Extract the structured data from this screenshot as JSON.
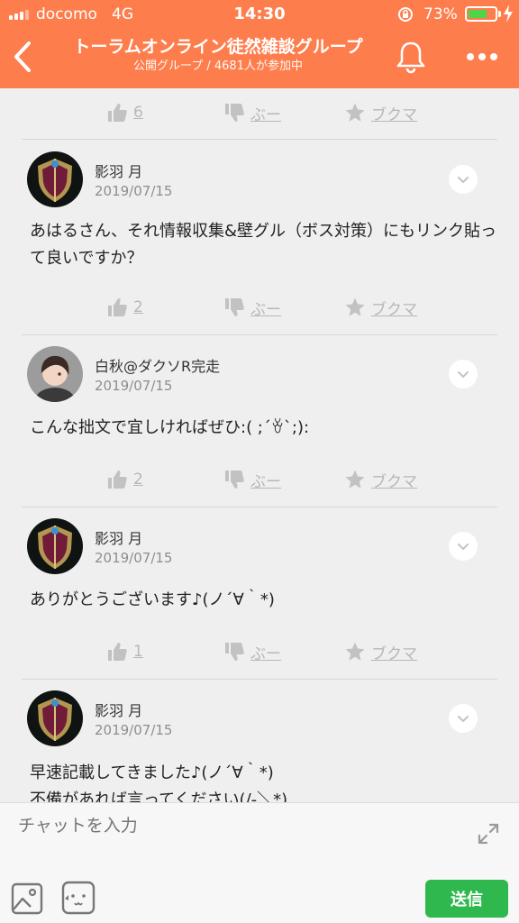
{
  "status_bar": {
    "carrier": "docomo",
    "network": "4G",
    "time": "14:30",
    "battery_percent": "73%",
    "battery_level": 0.73
  },
  "header": {
    "title": "トーラムオンライン徒然雑談グループ",
    "subtitle": "公開グループ / 4681人が参加中"
  },
  "action_labels": {
    "dislike": "ぶー",
    "bookmark": "ブクマ"
  },
  "top_actions": {
    "likes": "6"
  },
  "posts": [
    {
      "author": "影羽 月",
      "date": "2019/07/15",
      "avatar": "shield-crest",
      "text": "あはるさん、それ情報収集&壁グル（ボス対策）にもリンク貼って良いですか？",
      "likes": "2"
    },
    {
      "author": "白秋@ダクソR完走",
      "date": "2019/07/15",
      "avatar": "anime-character",
      "text": "こんな拙文で宜しければぜひ:( ;´ꈊ`;):",
      "likes": "2"
    },
    {
      "author": "影羽 月",
      "date": "2019/07/15",
      "avatar": "shield-crest",
      "text": "ありがとうございます♪(ノ´∀｀*)",
      "likes": "1"
    },
    {
      "author": "影羽 月",
      "date": "2019/07/15",
      "avatar": "shield-crest",
      "text": "早速記載してきました♪(ノ´∀｀*)\n不備があれば言ってください(/-＼*)"
    }
  ],
  "input": {
    "placeholder": "チャットを入力",
    "send_label": "送信"
  },
  "colors": {
    "header": "#fe7d4c",
    "send": "#2fb84d",
    "background": "#efefef"
  }
}
